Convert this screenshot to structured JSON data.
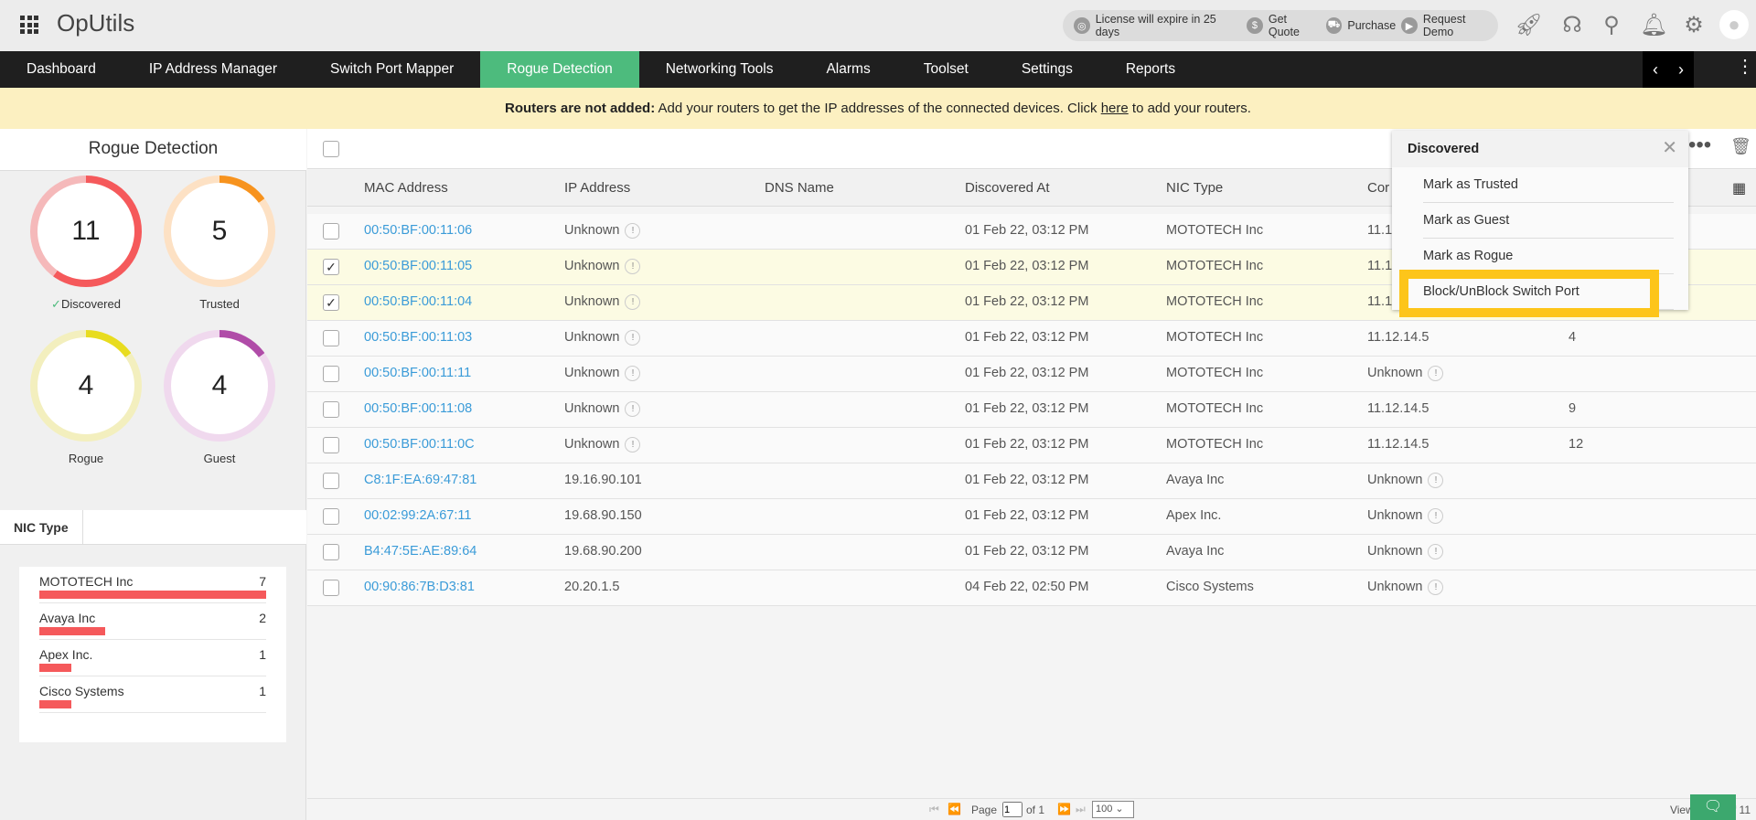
{
  "app": {
    "title": "OpUtils"
  },
  "header": {
    "license": "License will expire in 25 days",
    "quote": "Get Quote",
    "purchase": "Purchase",
    "demo": "Request Demo"
  },
  "nav": [
    {
      "label": "Dashboard"
    },
    {
      "label": "IP Address Manager"
    },
    {
      "label": "Switch Port Mapper"
    },
    {
      "label": "Rogue Detection",
      "active": true
    },
    {
      "label": "Networking Tools"
    },
    {
      "label": "Alarms"
    },
    {
      "label": "Toolset"
    },
    {
      "label": "Settings"
    },
    {
      "label": "Reports"
    }
  ],
  "banner": {
    "bold": "Routers are not added:",
    "text": " Add your routers to get the IP addresses of the connected devices. Click ",
    "link": "here",
    "tail": " to add your routers."
  },
  "left": {
    "title": "Rogue Detection",
    "stats": [
      {
        "label": "Discovered",
        "value": "11",
        "fraction": 0.6,
        "color": "#f5595b",
        "track": "#f5b9ba"
      },
      {
        "label": "Trusted",
        "value": "5",
        "fraction": 0.15,
        "color": "#f7931e",
        "track": "#fde1c4"
      },
      {
        "label": "Rogue",
        "value": "4",
        "fraction": 0.15,
        "color": "#e8dc1f",
        "track": "#f3efbe"
      },
      {
        "label": "Guest",
        "value": "4",
        "fraction": 0.15,
        "color": "#b04ca8",
        "track": "#f0d9ee"
      }
    ],
    "nic_tab": "NIC Type",
    "nic": [
      {
        "name": "MOTOTECH Inc",
        "count": "7",
        "fraction": 1
      },
      {
        "name": "Avaya Inc",
        "count": "2",
        "fraction": 0.29
      },
      {
        "name": "Apex Inc.",
        "count": "1",
        "fraction": 0.14
      },
      {
        "name": "Cisco Systems",
        "count": "1",
        "fraction": 0.14
      }
    ]
  },
  "table": {
    "headers": [
      "MAC Address",
      "IP Address",
      "DNS Name",
      "Discovered At",
      "NIC Type",
      "Cor"
    ],
    "rows": [
      {
        "mac": "00:50:BF:00:11:06",
        "ip": "Unknown",
        "at": "01 Feb 22, 03:12 PM",
        "nic": "MOTOTECH Inc",
        "con": "11.1",
        "port": "",
        "checked": false
      },
      {
        "mac": "00:50:BF:00:11:05",
        "ip": "Unknown",
        "at": "01 Feb 22, 03:12 PM",
        "nic": "MOTOTECH Inc",
        "con": "11.1",
        "port": "",
        "checked": true
      },
      {
        "mac": "00:50:BF:00:11:04",
        "ip": "Unknown",
        "at": "01 Feb 22, 03:12 PM",
        "nic": "MOTOTECH Inc",
        "con": "11.1",
        "port": "",
        "checked": true
      },
      {
        "mac": "00:50:BF:00:11:03",
        "ip": "Unknown",
        "at": "01 Feb 22, 03:12 PM",
        "nic": "MOTOTECH Inc",
        "con": "11.12.14.5",
        "port": "4",
        "checked": false
      },
      {
        "mac": "00:50:BF:00:11:11",
        "ip": "Unknown",
        "at": "01 Feb 22, 03:12 PM",
        "nic": "MOTOTECH Inc",
        "con": "Unknown",
        "port": "",
        "checked": false
      },
      {
        "mac": "00:50:BF:00:11:08",
        "ip": "Unknown",
        "at": "01 Feb 22, 03:12 PM",
        "nic": "MOTOTECH Inc",
        "con": "11.12.14.5",
        "port": "9",
        "checked": false
      },
      {
        "mac": "00:50:BF:00:11:0C",
        "ip": "Unknown",
        "at": "01 Feb 22, 03:12 PM",
        "nic": "MOTOTECH Inc",
        "con": "11.12.14.5",
        "port": "12",
        "checked": false
      },
      {
        "mac": "C8:1F:EA:69:47:81",
        "ip": "19.16.90.101",
        "at": "01 Feb 22, 03:12 PM",
        "nic": "Avaya Inc",
        "con": "Unknown",
        "port": "",
        "checked": false
      },
      {
        "mac": "00:02:99:2A:67:11",
        "ip": "19.68.90.150",
        "at": "01 Feb 22, 03:12 PM",
        "nic": "Apex Inc.",
        "con": "Unknown",
        "port": "",
        "checked": false
      },
      {
        "mac": "B4:47:5E:AE:89:64",
        "ip": "19.68.90.200",
        "at": "01 Feb 22, 03:12 PM",
        "nic": "Avaya Inc",
        "con": "Unknown",
        "port": "",
        "checked": false
      },
      {
        "mac": "00:90:86:7B:D3:81",
        "ip": "20.20.1.5",
        "at": "04 Feb 22, 02:50 PM",
        "nic": "Cisco Systems",
        "con": "Unknown",
        "port": "",
        "checked": false
      }
    ]
  },
  "popup": {
    "title": "Discovered",
    "items": [
      "Mark as Trusted",
      "Mark as Guest",
      "Mark as Rogue",
      "Block/UnBlock Switch Port"
    ]
  },
  "footer": {
    "page_label": "Page",
    "page": "1",
    "of": "of 1",
    "per_page": "100",
    "view": "View 1 - 11 of 11"
  }
}
